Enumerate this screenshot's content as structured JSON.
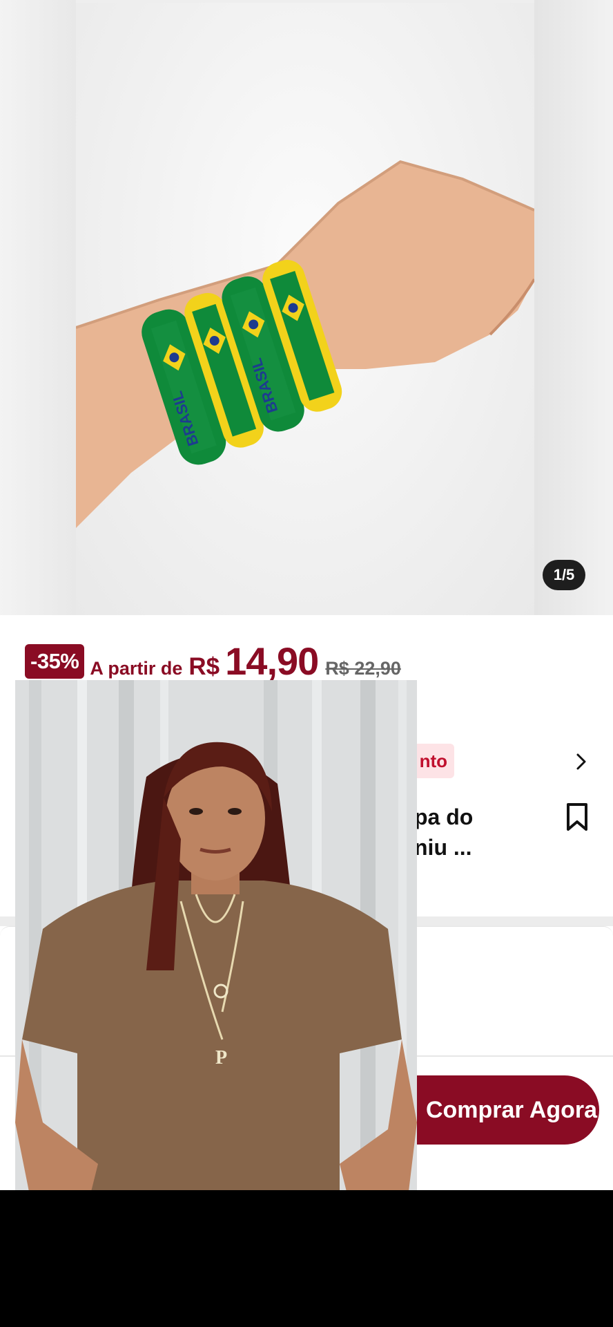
{
  "gallery": {
    "counter": "1/5",
    "bracelet_text": "BRASIL"
  },
  "price": {
    "discount": "-35%",
    "from_label": "A partir de",
    "currency": "R$",
    "value": "14,90",
    "original": "R$ 22,90"
  },
  "product": {
    "tag_fragment": "nto",
    "title_fragment_line1": "pa do",
    "title_fragment_line2": "niu ..."
  },
  "actions": {
    "buy_label": "Comprar Agora"
  },
  "video": {
    "pendant_letter": "P"
  },
  "icons": {
    "chevron": "chevron-right-icon",
    "bookmark": "bookmark-icon"
  },
  "colors": {
    "brand": "#8a0c24",
    "tag_bg": "#fde3e6",
    "bracelet_green": "#0f8a3a",
    "bracelet_yellow": "#f2d21b"
  }
}
